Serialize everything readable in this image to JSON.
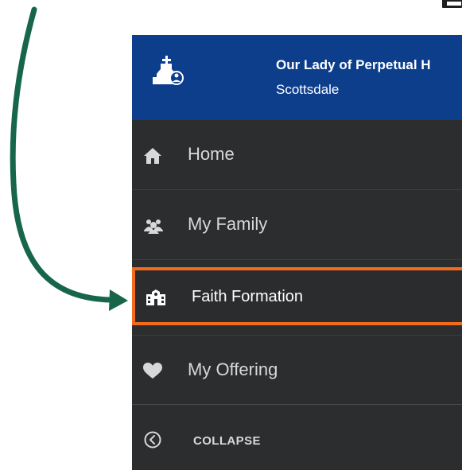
{
  "header": {
    "parish_name": "Our Lady of Perpetual H",
    "city": "Scottsdale",
    "logo_icon": "church-person-icon"
  },
  "nav": {
    "items": [
      {
        "label": "Home",
        "icon": "home-icon",
        "selected": false
      },
      {
        "label": "My Family",
        "icon": "users-icon",
        "selected": false
      },
      {
        "label": "Faith Formation",
        "icon": "school-icon",
        "selected": true
      },
      {
        "label": "My Offering",
        "icon": "heart-icon",
        "selected": false
      }
    ]
  },
  "footer": {
    "collapse_label": "COLLAPSE",
    "collapse_icon": "chevron-left-circle-icon"
  },
  "annotation": {
    "arrow_color": "#17664a",
    "highlight_color": "#f26b1d"
  },
  "colors": {
    "header_bg": "#0c3e8c",
    "sidebar_bg": "#2b2d2f",
    "text_light": "#d8d8d8"
  }
}
